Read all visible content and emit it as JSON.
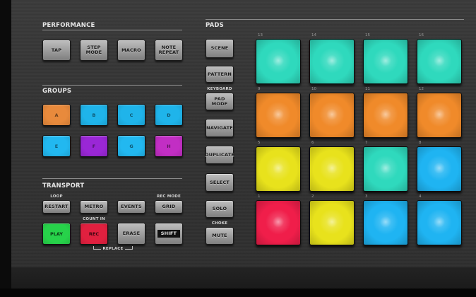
{
  "performance": {
    "title": "PERFORMANCE",
    "buttons": [
      {
        "label": "TAP"
      },
      {
        "label": "STEP\nMODE"
      },
      {
        "label": "MACRO"
      },
      {
        "label": "NOTE\nREPEAT"
      }
    ]
  },
  "groups": {
    "title": "GROUPS",
    "buttons": [
      {
        "label": "A",
        "color": "#e88a3c"
      },
      {
        "label": "B",
        "color": "#1fb4ea"
      },
      {
        "label": "C",
        "color": "#1fb4ea"
      },
      {
        "label": "D",
        "color": "#1fb4ea"
      },
      {
        "label": "E",
        "color": "#22b8f0"
      },
      {
        "label": "F",
        "color": "#9a27d6"
      },
      {
        "label": "G",
        "color": "#22b8f0"
      },
      {
        "label": "H",
        "color": "#c22ec4"
      }
    ]
  },
  "transport": {
    "title": "TRANSPORT",
    "loop_label": "LOOP",
    "rec_mode_label": "REC MODE",
    "count_in_label": "COUNT IN",
    "replace_label": "REPLACE",
    "restart": "RESTART",
    "metro": "METRO",
    "events": "EVENTS",
    "grid": "GRID",
    "play": "PLAY",
    "rec": "REC",
    "erase": "ERASE",
    "shift": "SHIFT",
    "colors": {
      "play": "#27d24a",
      "rec": "#e0203f",
      "shift": "#111111"
    }
  },
  "pads_section": {
    "title": "PADS",
    "keyboard_label": "KEYBOARD",
    "choke_label": "CHOKE",
    "buttons": [
      {
        "label": "SCENE"
      },
      {
        "label": "PATTERN"
      },
      {
        "label": "PAD MODE"
      },
      {
        "label": "NAVIGATE"
      },
      {
        "label": "DUPLICATE"
      },
      {
        "label": "SELECT"
      },
      {
        "label": "SOLO"
      },
      {
        "label": "MUTE"
      }
    ]
  },
  "pads": [
    {
      "number": "13",
      "color": "#2fd9bd"
    },
    {
      "number": "14",
      "color": "#2fd9bd"
    },
    {
      "number": "15",
      "color": "#2fd9bd"
    },
    {
      "number": "16",
      "color": "#2fd9bd"
    },
    {
      "number": "9",
      "color": "#f08a2a"
    },
    {
      "number": "10",
      "color": "#f08a2a"
    },
    {
      "number": "11",
      "color": "#f08a2a"
    },
    {
      "number": "12",
      "color": "#f08a2a"
    },
    {
      "number": "5",
      "color": "#e8e21c"
    },
    {
      "number": "6",
      "color": "#e8e21c"
    },
    {
      "number": "7",
      "color": "#2fd9bd"
    },
    {
      "number": "8",
      "color": "#1fb4f2"
    },
    {
      "number": "1",
      "color": "#f01e4a"
    },
    {
      "number": "2",
      "color": "#e8e21c"
    },
    {
      "number": "3",
      "color": "#1fb4f2"
    },
    {
      "number": "4",
      "color": "#1fb4f2"
    }
  ]
}
